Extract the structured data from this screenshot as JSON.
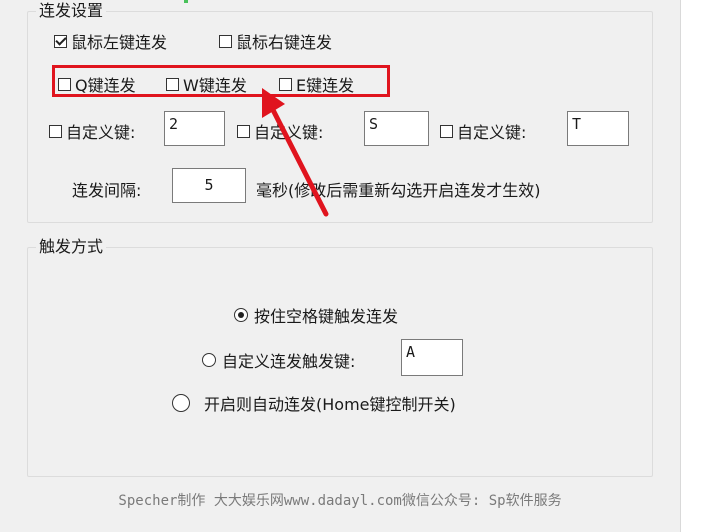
{
  "group_burst": {
    "title": "连发设置",
    "mouse_left": {
      "label": "鼠标左键连发",
      "checked": true
    },
    "mouse_right": {
      "label": "鼠标右键连发",
      "checked": false
    },
    "q_key": {
      "label": "Q键连发",
      "checked": false
    },
    "w_key": {
      "label": "W键连发",
      "checked": false
    },
    "e_key": {
      "label": "E键连发",
      "checked": false
    },
    "custom_keys": [
      {
        "label": "自定义键:",
        "value": "2",
        "checked": false
      },
      {
        "label": "自定义键:",
        "value": "S",
        "checked": false
      },
      {
        "label": "自定义键:",
        "value": "T",
        "checked": false
      }
    ],
    "interval_label": "连发间隔:",
    "interval_value": "5",
    "interval_hint": "毫秒(修改后需重新勾选开启连发才生效)"
  },
  "group_trigger": {
    "title": "触发方式",
    "options": [
      {
        "label": "按住空格键触发连发",
        "selected": true
      },
      {
        "label": "自定义连发触发键:",
        "selected": false,
        "value": "A"
      },
      {
        "label": "开启则自动连发(Home键控制开关)",
        "selected": false
      }
    ]
  },
  "footer": "Specher制作 大大娱乐网www.dadayl.com微信公众号: Sp软件服务",
  "annotation": {
    "box_color": "#e0141e"
  }
}
